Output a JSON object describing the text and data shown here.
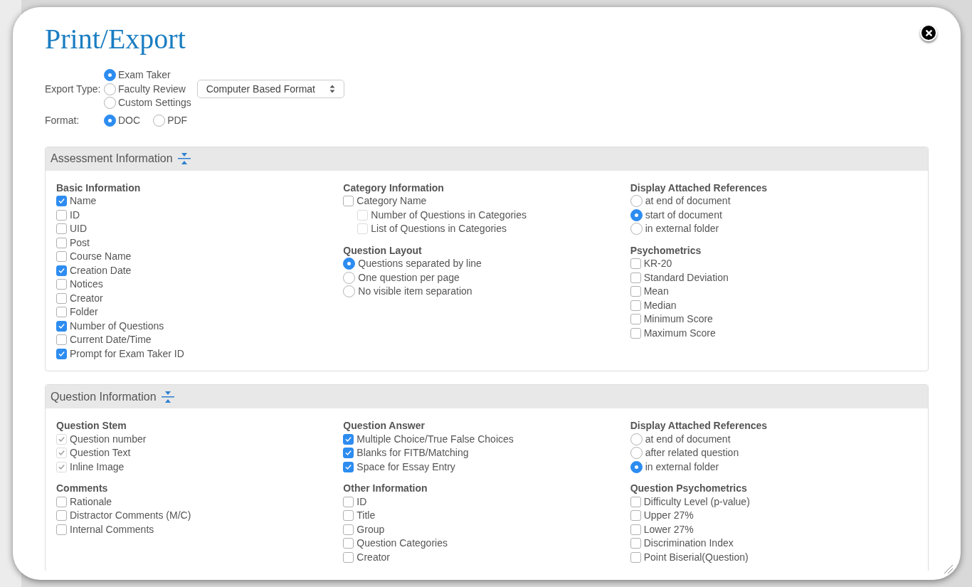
{
  "dialog": {
    "title": "Print/Export"
  },
  "export_type": {
    "label": "Export Type:",
    "options": [
      {
        "label": "Exam Taker",
        "selected": true
      },
      {
        "label": "Faculty Review",
        "selected": false
      },
      {
        "label": "Custom Settings",
        "selected": false
      }
    ]
  },
  "format_select": {
    "value": "Computer Based Format"
  },
  "format": {
    "label": "Format:",
    "options": [
      {
        "label": "DOC",
        "selected": true
      },
      {
        "label": "PDF",
        "selected": false
      }
    ]
  },
  "sections": [
    {
      "title": "Assessment Information",
      "columns": [
        [
          {
            "heading": "Basic Information",
            "items": [
              {
                "kind": "checkbox",
                "label": "Name",
                "checked": true,
                "disabled": false
              },
              {
                "kind": "checkbox",
                "label": "ID",
                "checked": false,
                "disabled": false
              },
              {
                "kind": "checkbox",
                "label": "UID",
                "checked": false,
                "disabled": false
              },
              {
                "kind": "checkbox",
                "label": "Post",
                "checked": false,
                "disabled": false
              },
              {
                "kind": "checkbox",
                "label": "Course Name",
                "checked": false,
                "disabled": false
              },
              {
                "kind": "checkbox",
                "label": "Creation Date",
                "checked": true,
                "disabled": false
              },
              {
                "kind": "checkbox",
                "label": "Notices",
                "checked": false,
                "disabled": false
              },
              {
                "kind": "checkbox",
                "label": "Creator",
                "checked": false,
                "disabled": false
              },
              {
                "kind": "checkbox",
                "label": "Folder",
                "checked": false,
                "disabled": false
              },
              {
                "kind": "checkbox",
                "label": "Number of Questions",
                "checked": true,
                "disabled": false
              },
              {
                "kind": "checkbox",
                "label": "Current Date/Time",
                "checked": false,
                "disabled": false
              },
              {
                "kind": "checkbox",
                "label": "Prompt for Exam Taker ID",
                "checked": true,
                "disabled": false
              }
            ]
          }
        ],
        [
          {
            "heading": "Category Information",
            "items": [
              {
                "kind": "checkbox",
                "label": "Category Name",
                "checked": false,
                "disabled": false,
                "children": [
                  {
                    "kind": "checkbox",
                    "label": "Number of Questions in Categories",
                    "checked": false,
                    "disabled": true
                  },
                  {
                    "kind": "checkbox",
                    "label": "List of Questions in Categories",
                    "checked": false,
                    "disabled": true
                  }
                ]
              }
            ]
          },
          {
            "heading": "Question Layout",
            "items": [
              {
                "kind": "radio",
                "label": "Questions separated by line",
                "selected": true
              },
              {
                "kind": "radio",
                "label": "One question per page",
                "selected": false
              },
              {
                "kind": "radio",
                "label": "No visible item separation",
                "selected": false
              }
            ]
          }
        ],
        [
          {
            "heading": "Display Attached References",
            "items": [
              {
                "kind": "radio",
                "label": "at end of document",
                "selected": false
              },
              {
                "kind": "radio",
                "label": "start of document",
                "selected": true
              },
              {
                "kind": "radio",
                "label": "in external folder",
                "selected": false
              }
            ]
          },
          {
            "heading": "Psychometrics",
            "items": [
              {
                "kind": "checkbox",
                "label": "KR-20",
                "checked": false,
                "disabled": false
              },
              {
                "kind": "checkbox",
                "label": "Standard Deviation",
                "checked": false,
                "disabled": false
              },
              {
                "kind": "checkbox",
                "label": "Mean",
                "checked": false,
                "disabled": false
              },
              {
                "kind": "checkbox",
                "label": "Median",
                "checked": false,
                "disabled": false
              },
              {
                "kind": "checkbox",
                "label": "Minimum Score",
                "checked": false,
                "disabled": false
              },
              {
                "kind": "checkbox",
                "label": "Maximum Score",
                "checked": false,
                "disabled": false
              }
            ]
          }
        ]
      ]
    },
    {
      "title": "Question Information",
      "columns": [
        [
          {
            "heading": "Question Stem",
            "items": [
              {
                "kind": "checkbox",
                "label": "Question number",
                "checked": true,
                "disabled": true
              },
              {
                "kind": "checkbox",
                "label": "Question Text",
                "checked": true,
                "disabled": true
              },
              {
                "kind": "checkbox",
                "label": "Inline Image",
                "checked": true,
                "disabled": true
              }
            ]
          },
          {
            "heading": "Comments",
            "items": [
              {
                "kind": "checkbox",
                "label": "Rationale",
                "checked": false,
                "disabled": false
              },
              {
                "kind": "checkbox",
                "label": "Distractor Comments (M/C)",
                "checked": false,
                "disabled": false
              },
              {
                "kind": "checkbox",
                "label": "Internal Comments",
                "checked": false,
                "disabled": false
              }
            ]
          }
        ],
        [
          {
            "heading": "Question Answer",
            "items": [
              {
                "kind": "checkbox",
                "label": "Multiple Choice/True False Choices",
                "checked": true,
                "disabled": false
              },
              {
                "kind": "checkbox",
                "label": "Blanks for FITB/Matching",
                "checked": true,
                "disabled": false
              },
              {
                "kind": "checkbox",
                "label": "Space for Essay Entry",
                "checked": true,
                "disabled": false
              }
            ]
          },
          {
            "heading": "Other Information",
            "items": [
              {
                "kind": "checkbox",
                "label": "ID",
                "checked": false,
                "disabled": false
              },
              {
                "kind": "checkbox",
                "label": "Title",
                "checked": false,
                "disabled": false
              },
              {
                "kind": "checkbox",
                "label": "Group",
                "checked": false,
                "disabled": false
              },
              {
                "kind": "checkbox",
                "label": "Question Categories",
                "checked": false,
                "disabled": false
              },
              {
                "kind": "checkbox",
                "label": "Creator",
                "checked": false,
                "disabled": false
              }
            ]
          }
        ],
        [
          {
            "heading": "Display Attached References",
            "items": [
              {
                "kind": "radio",
                "label": "at end of document",
                "selected": false
              },
              {
                "kind": "radio",
                "label": "after related question",
                "selected": false
              },
              {
                "kind": "radio",
                "label": "in external folder",
                "selected": true
              }
            ]
          },
          {
            "heading": "Question Psychometrics",
            "items": [
              {
                "kind": "checkbox",
                "label": "Difficulty Level (p-value)",
                "checked": false,
                "disabled": false
              },
              {
                "kind": "checkbox",
                "label": "Upper 27%",
                "checked": false,
                "disabled": false
              },
              {
                "kind": "checkbox",
                "label": "Lower 27%",
                "checked": false,
                "disabled": false
              },
              {
                "kind": "checkbox",
                "label": "Discrimination Index",
                "checked": false,
                "disabled": false
              },
              {
                "kind": "checkbox",
                "label": "Point Biserial(Question)",
                "checked": false,
                "disabled": false
              }
            ]
          }
        ]
      ]
    }
  ]
}
